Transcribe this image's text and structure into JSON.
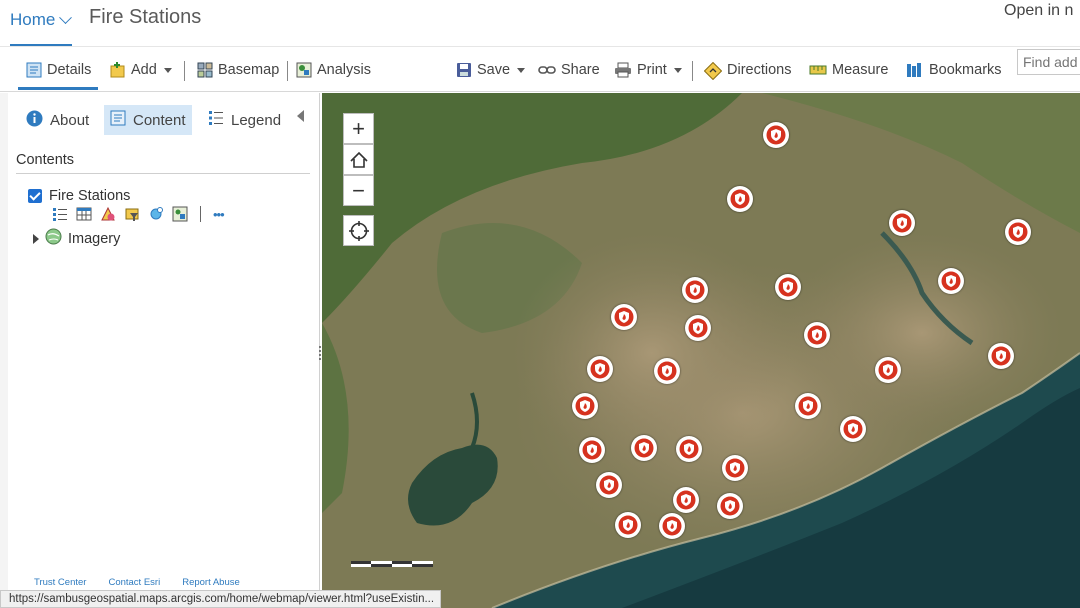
{
  "header": {
    "home_label": "Home",
    "title": "Fire Stations",
    "open_in": "Open in n"
  },
  "toolbar": {
    "details": "Details",
    "add": "Add",
    "basemap": "Basemap",
    "analysis": "Analysis",
    "save": "Save",
    "share": "Share",
    "print": "Print",
    "directions": "Directions",
    "measure": "Measure",
    "bookmarks": "Bookmarks",
    "find_placeholder": "Find add"
  },
  "panel": {
    "tabs": {
      "about": "About",
      "content": "Content",
      "legend": "Legend"
    },
    "active_tab": "Content",
    "contents_heading": "Contents",
    "layers": [
      {
        "name": "Fire Stations",
        "checked": true
      },
      {
        "name": "Imagery"
      }
    ],
    "layer_tool_icons": [
      "show-table-icon",
      "attribute-table-icon",
      "change-style-icon",
      "filter-icon",
      "perform-analysis-icon",
      "show-labels-icon",
      "more-options-icon"
    ],
    "more_label": "•••",
    "footer": {
      "trust_center": "Trust Center",
      "contact": "Contact Esri",
      "report": "Report Abuse"
    }
  },
  "map": {
    "zoom_in": "+",
    "zoom_out": "−",
    "station_count": 27,
    "station_color": "#d6321f"
  },
  "status_bar": {
    "url": "https://sambusgeospatial.maps.arcgis.com/home/webmap/viewer.html?useExistin..."
  },
  "colors": {
    "accent": "#2f7bbf",
    "active_tab_bg": "#d5e7f7",
    "sea": "#16373d",
    "land": "#8e8360"
  }
}
